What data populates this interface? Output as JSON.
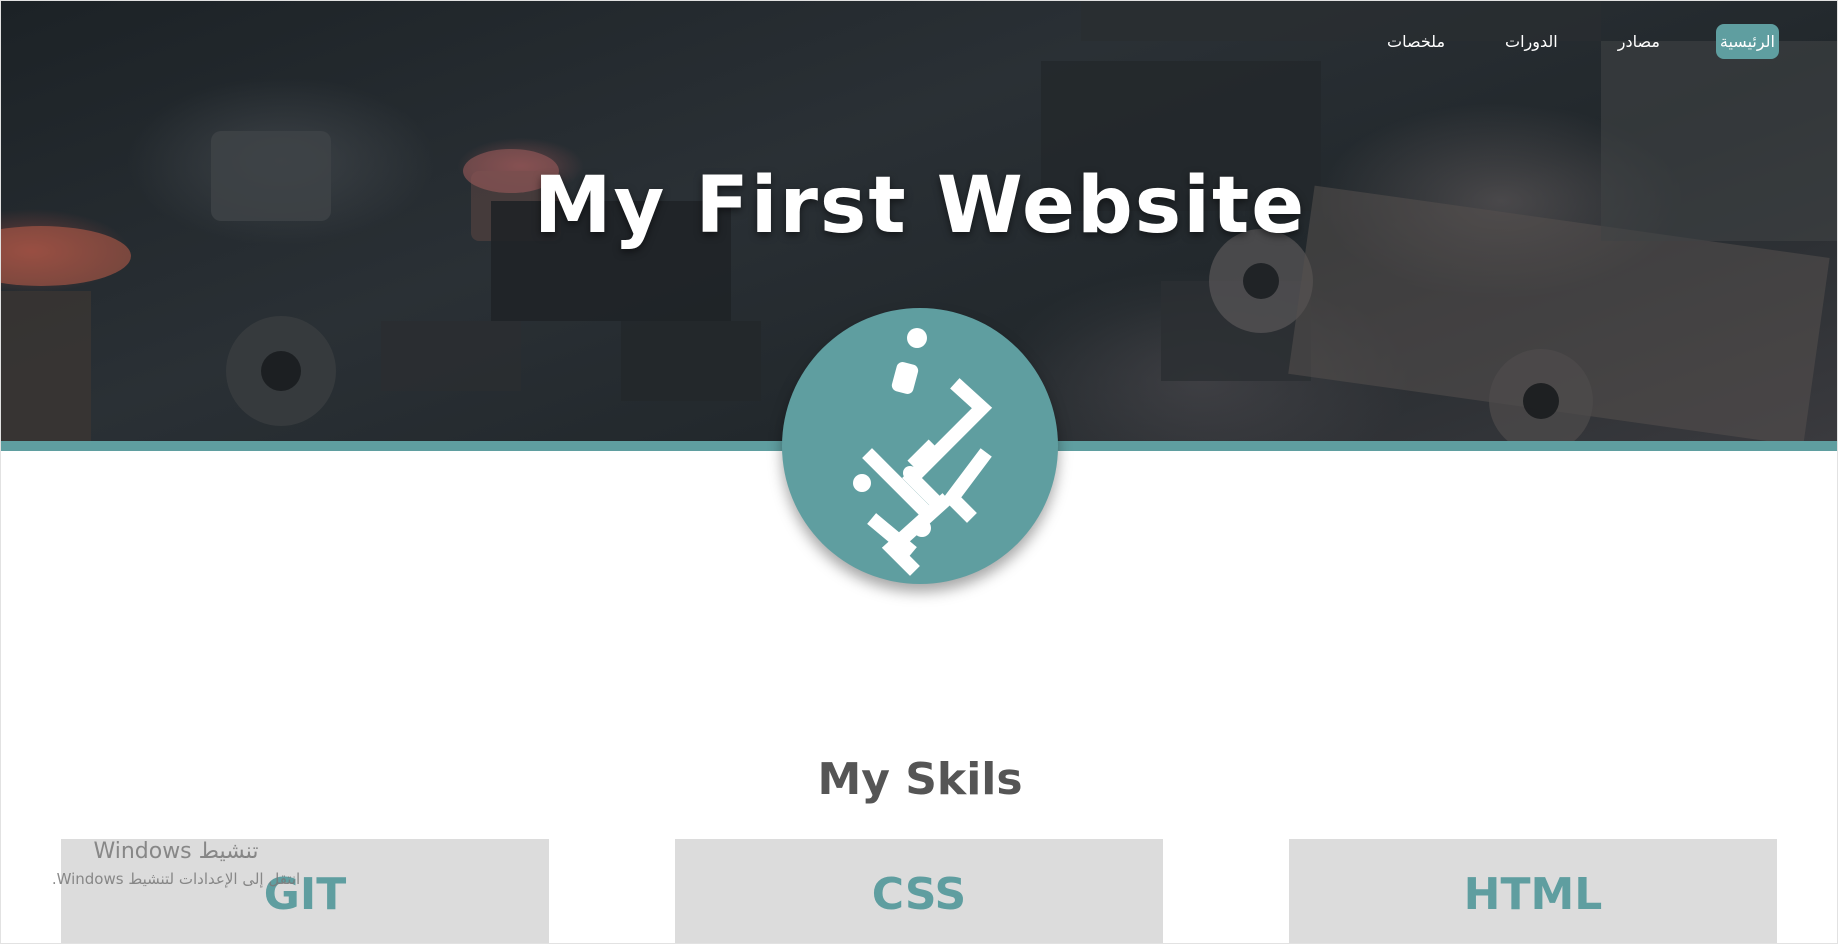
{
  "nav": {
    "items": [
      {
        "label": "الرئيسية",
        "active": true
      },
      {
        "label": "مصادر",
        "active": false
      },
      {
        "label": "الدورات",
        "active": false
      },
      {
        "label": "ملخصات",
        "active": false
      }
    ]
  },
  "hero": {
    "title": "My First Website"
  },
  "logo": {
    "icon": "arabic-calligraphy-logo-icon"
  },
  "skills": {
    "title": "My Skils",
    "cards": [
      {
        "label": "GIT"
      },
      {
        "label": "CSS"
      },
      {
        "label": "HTML"
      }
    ]
  },
  "watermark": {
    "title": "تنشيط Windows",
    "subtitle": "انتقل إلى الإعدادات لتنشيط Windows."
  },
  "colors": {
    "accent": "#5f9ea0",
    "card_bg": "#dcdcdc",
    "title_text": "#555555"
  }
}
